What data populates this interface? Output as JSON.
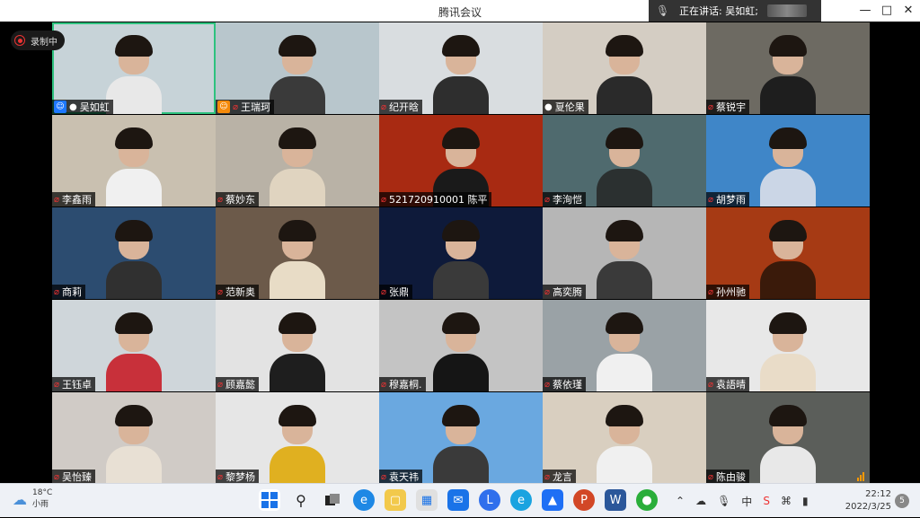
{
  "window": {
    "title": "腾讯会议",
    "speaker_prefix": "正在讲话:",
    "speaker_name": "吴如虹;"
  },
  "recording": {
    "label": "录制中"
  },
  "participants": [
    {
      "name": "吴如虹",
      "row": 0,
      "col": 0,
      "host": "true",
      "mic": "on",
      "bg": "#c7d3d8",
      "shirt": "#e8e8e8",
      "speaking": "true"
    },
    {
      "name": "王瑞珂",
      "row": 0,
      "col": 1,
      "host": "true",
      "host_color": "#f58a0a",
      "mic": "muted",
      "bg": "#b8c6cc",
      "shirt": "#3a3a3a"
    },
    {
      "name": "纪开晗",
      "row": 0,
      "col": 2,
      "mic": "muted",
      "bg": "#d9dde0",
      "shirt": "#2e2e2e"
    },
    {
      "name": "夏伦果",
      "row": 0,
      "col": 3,
      "mic": "on",
      "bg": "#d4cdc3",
      "shirt": "#2a2a2a"
    },
    {
      "name": "蔡锐宇",
      "row": 0,
      "col": 4,
      "mic": "muted",
      "bg": "#6d6a62",
      "shirt": "#1e1e1e"
    },
    {
      "name": "李鑫雨",
      "row": 1,
      "col": 0,
      "mic": "muted",
      "bg": "#c9c0b0",
      "shirt": "#f0f0f0"
    },
    {
      "name": "蔡妙东",
      "row": 1,
      "col": 1,
      "mic": "muted",
      "bg": "#b9b2a6",
      "shirt": "#e0d4c0"
    },
    {
      "name": "521720910001 陈平",
      "row": 1,
      "col": 2,
      "mic": "muted",
      "bg": "#a82a12",
      "shirt": "#1a1a1a"
    },
    {
      "name": "李洵恺",
      "row": 1,
      "col": 3,
      "mic": "muted",
      "bg": "#4f6a6e",
      "shirt": "#2b3030"
    },
    {
      "name": "胡梦雨",
      "row": 1,
      "col": 4,
      "mic": "muted",
      "bg": "#3f86c8",
      "shirt": "#cbd6e6"
    },
    {
      "name": "商莉",
      "row": 2,
      "col": 0,
      "mic": "muted",
      "bg": "#2c4c70",
      "shirt": "#303030"
    },
    {
      "name": "范新奥",
      "row": 2,
      "col": 1,
      "mic": "muted",
      "bg": "#6c5a4a",
      "shirt": "#e8dcc6"
    },
    {
      "name": "张鼎",
      "row": 2,
      "col": 2,
      "mic": "muted",
      "bg": "#0e1a3a",
      "shirt": "#3a3a3a"
    },
    {
      "name": "高奕腾",
      "row": 2,
      "col": 3,
      "mic": "muted",
      "bg": "#b6b6b6",
      "shirt": "#3a3a3a"
    },
    {
      "name": "孙州驰",
      "row": 2,
      "col": 4,
      "mic": "muted",
      "bg": "#a63a14",
      "shirt": "#3a1a0a"
    },
    {
      "name": "王钰卓",
      "row": 3,
      "col": 0,
      "mic": "muted",
      "bg": "#cfd6da",
      "shirt": "#c8303a"
    },
    {
      "name": "顾嘉懿",
      "row": 3,
      "col": 1,
      "mic": "muted",
      "bg": "#e3e3e3",
      "shirt": "#1e1e1e"
    },
    {
      "name": "穆嘉桐.",
      "row": 3,
      "col": 2,
      "mic": "muted",
      "bg": "#c4c4c4",
      "shirt": "#151515"
    },
    {
      "name": "蔡依瑾",
      "row": 3,
      "col": 3,
      "mic": "muted",
      "bg": "#9aa2a6",
      "shirt": "#f0f0f0"
    },
    {
      "name": "袁語晴",
      "row": 3,
      "col": 4,
      "mic": "muted",
      "bg": "#e8e8e8",
      "shirt": "#e9dcc8"
    },
    {
      "name": "吴怡臻",
      "row": 4,
      "col": 0,
      "mic": "muted",
      "bg": "#d0cbc6",
      "shirt": "#e8e0d4"
    },
    {
      "name": "黎梦杨",
      "row": 4,
      "col": 1,
      "mic": "muted",
      "bg": "#e6e6e6",
      "shirt": "#e0b020"
    },
    {
      "name": "袁天祎",
      "row": 4,
      "col": 2,
      "mic": "muted",
      "bg": "#6aa8e0",
      "shirt": "#3a3a3a"
    },
    {
      "name": "龙言",
      "row": 4,
      "col": 3,
      "mic": "muted",
      "bg": "#d9cfc0",
      "shirt": "#f0f0f0"
    },
    {
      "name": "陈由骏",
      "row": 4,
      "col": 4,
      "mic": "muted",
      "bg": "#5b5e5a",
      "shirt": "#e8e8e8",
      "signal": "weak"
    }
  ],
  "taskbar": {
    "weather_temp": "18°C",
    "weather_desc": "小雨",
    "time": "22:12",
    "date": "2022/3/25",
    "ime": "中",
    "notifications": "5",
    "apps": [
      "windows-start",
      "search",
      "task-view",
      "edge",
      "file-explorer",
      "store",
      "mail",
      "lark",
      "edge-dev",
      "tencent-meeting",
      "powerpoint",
      "word",
      "wechat"
    ]
  },
  "colors": {
    "muted_mic": "#e33333",
    "host_badge": "#1e78ff",
    "speaking_border": "#2ec27e"
  }
}
